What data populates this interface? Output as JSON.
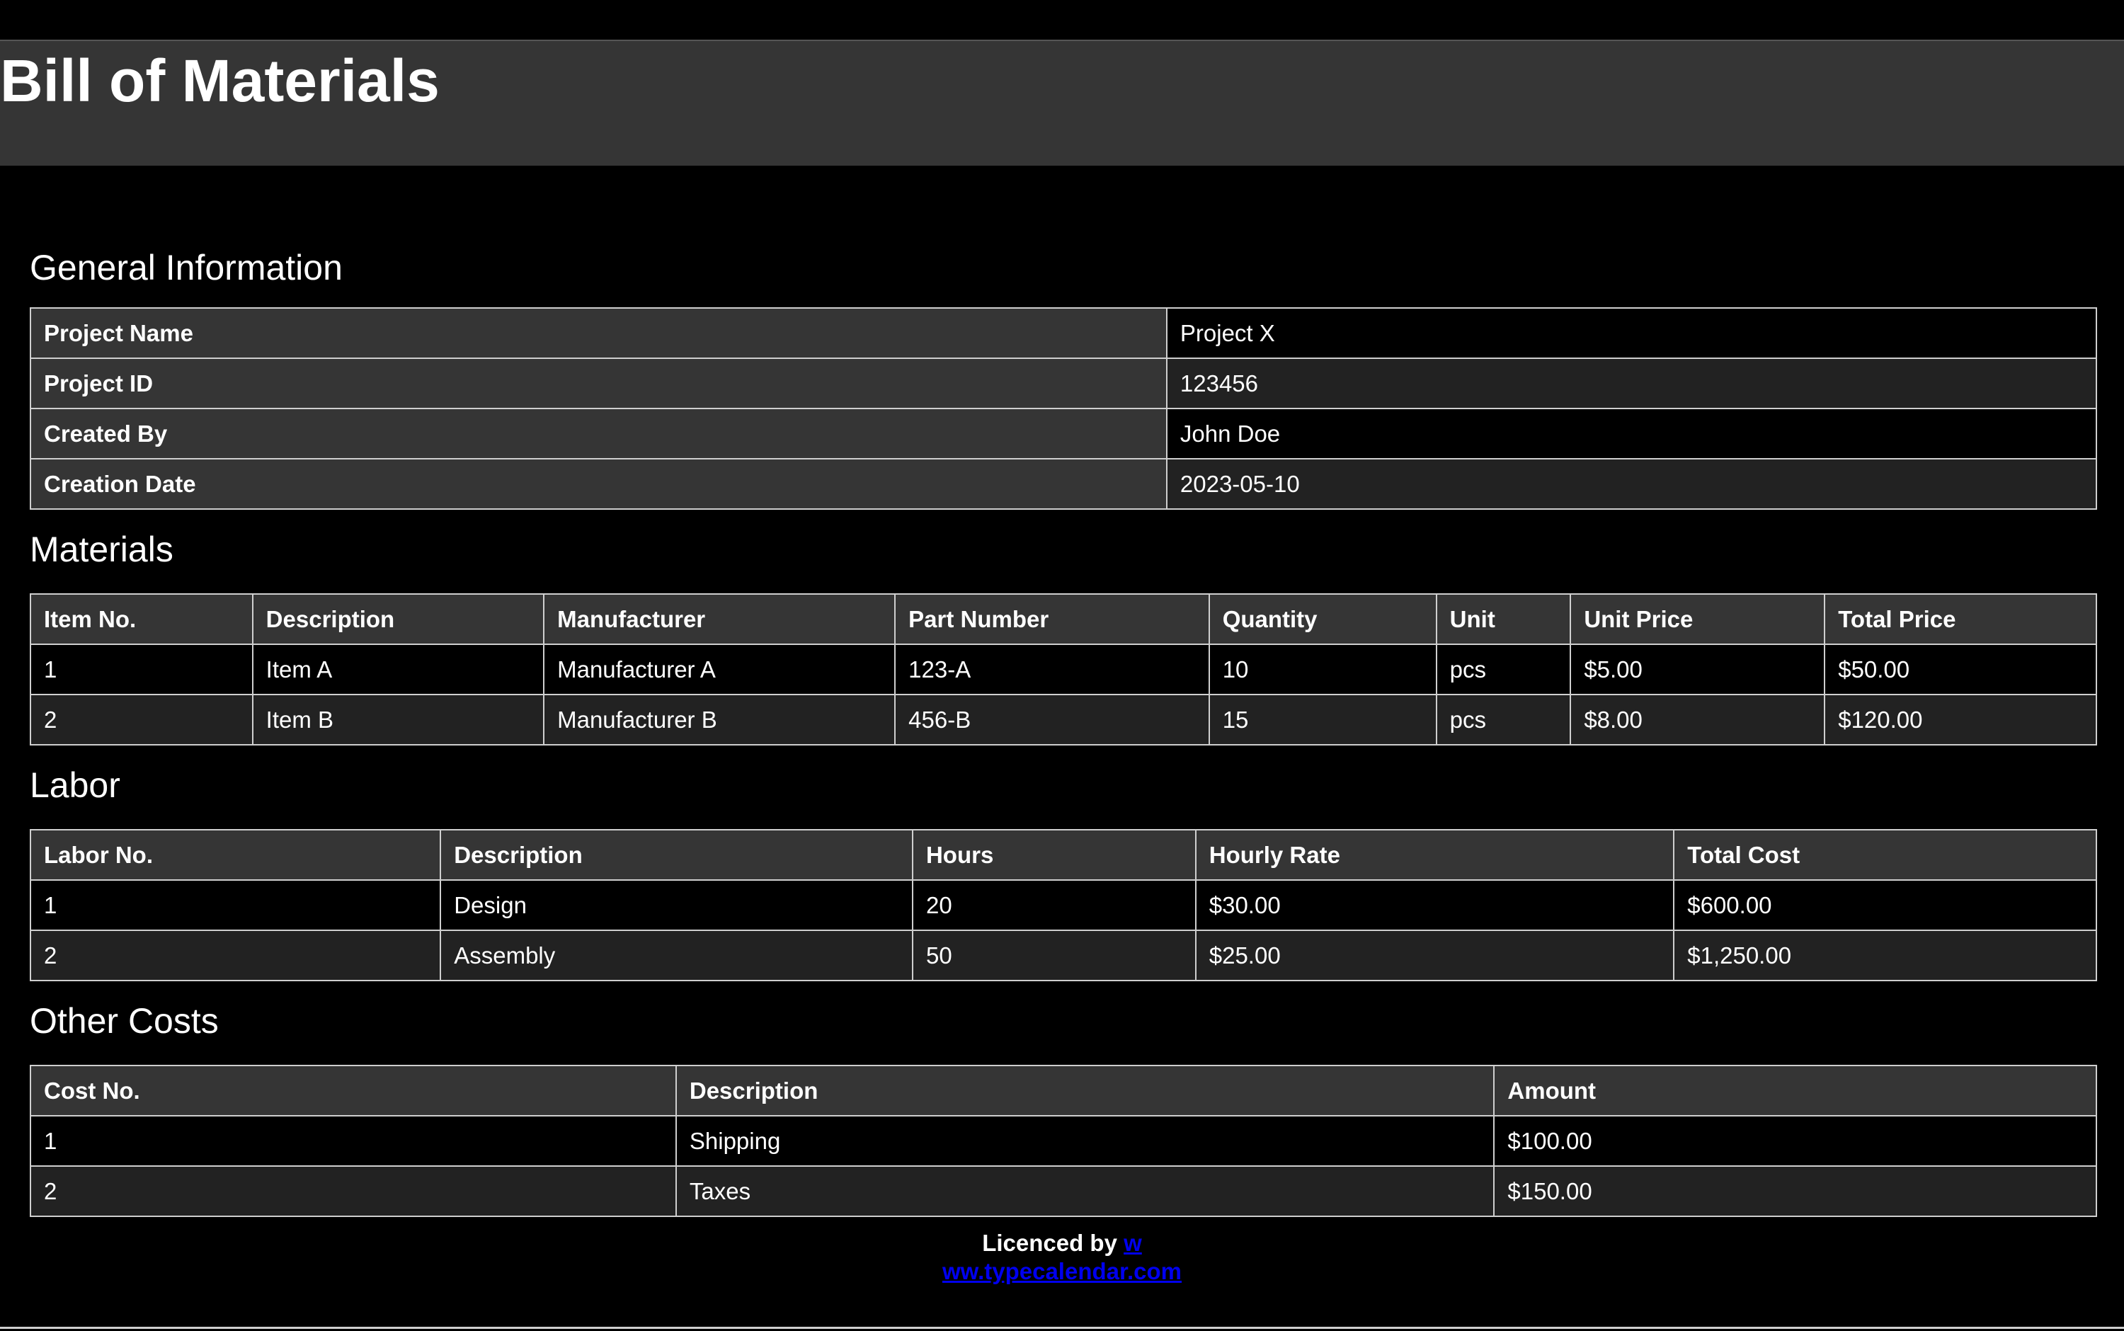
{
  "title": "Bill of Materials",
  "colors": {
    "background": "#000000",
    "header_bg": "#353535",
    "row_alt": "#222222",
    "border": "#cfcfcf",
    "link": "#0000ee"
  },
  "general": {
    "heading": "General Information",
    "rows": [
      {
        "key": "Project Name",
        "value": "Project X"
      },
      {
        "key": "Project ID",
        "value": "123456"
      },
      {
        "key": "Created By",
        "value": "John Doe"
      },
      {
        "key": "Creation Date",
        "value": "2023-05-10"
      }
    ]
  },
  "materials": {
    "heading": "Materials",
    "columns": [
      "Item No.",
      "Description",
      "Manufacturer",
      "Part Number",
      "Quantity",
      "Unit",
      "Unit Price",
      "Total Price"
    ],
    "rows": [
      [
        "1",
        "Item A",
        "Manufacturer A",
        "123-A",
        "10",
        "pcs",
        "$5.00",
        "$50.00"
      ],
      [
        "2",
        "Item B",
        "Manufacturer B",
        "456-B",
        "15",
        "pcs",
        "$8.00",
        "$120.00"
      ]
    ]
  },
  "labor": {
    "heading": "Labor",
    "columns": [
      "Labor No.",
      "Description",
      "Hours",
      "Hourly Rate",
      "Total Cost"
    ],
    "rows": [
      [
        "1",
        "Design",
        "20",
        "$30.00",
        "$600.00"
      ],
      [
        "2",
        "Assembly",
        "50",
        "$25.00",
        "$1,250.00"
      ]
    ]
  },
  "other_costs": {
    "heading": "Other Costs",
    "columns": [
      "Cost No.",
      "Description",
      "Amount"
    ],
    "rows": [
      [
        "1",
        "Shipping",
        "$100.00"
      ],
      [
        "2",
        "Taxes",
        "$150.00"
      ]
    ]
  },
  "footer": {
    "prefix": "Licenced by ",
    "link_part1": "w",
    "link_part2": "ww.typecalendar.com"
  }
}
